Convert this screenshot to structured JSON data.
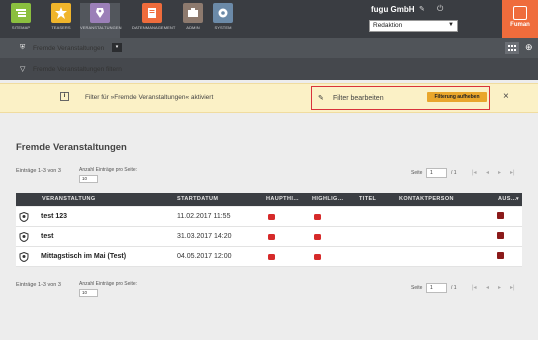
{
  "nav": {
    "items": [
      {
        "label": "SITEMAP",
        "color": "#8bbf3f"
      },
      {
        "label": "TEASERS",
        "color": "#f0b52b"
      },
      {
        "label": "VERANSTALTUNGEN",
        "color": "#9b7fb8"
      },
      {
        "label": "DATENMANAGEMENT",
        "color": "#ef6c3c"
      },
      {
        "label": "ADMIN",
        "color": "#8d7a6e"
      },
      {
        "label": "SYSTEM",
        "color": "#6b8aa8"
      }
    ],
    "active_index": 2,
    "company": "fugu GmbH",
    "redaktion": "Redaktion",
    "brand": "Fuman",
    "brand_color": "#ef6c3c"
  },
  "subbar": {
    "title": "Fremde Veranstaltungen",
    "filter_link": "Fremde Veranstaltungen filtern"
  },
  "banner": {
    "message": "Filter für »Fremde Veranstaltungen« aktiviert",
    "edit_label": "Filter bearbeiten",
    "remove_label": "Filterung aufheben",
    "close": "×"
  },
  "page": {
    "title": "Fremde Veranstaltungen",
    "entries_text": "Einträge 1-3 von 3",
    "per_page_label": "Anzahl Einträge pro Seite:",
    "per_page_value": "10",
    "pager_label": "Seite",
    "pager_value": "1",
    "pager_total": "/ 1"
  },
  "table": {
    "headers": [
      "VERANSTALTUNG",
      "STARTDATUM",
      "HAUPTHI…",
      "HIGHLIG…",
      "TITEL",
      "KONTAKTPERSON",
      "AUS…"
    ],
    "rows": [
      {
        "name": "test 123",
        "date": "11.02.2017 11:55"
      },
      {
        "name": "test",
        "date": "31.03.2017 14:20"
      },
      {
        "name": "Mittagstisch im Mai (Test)",
        "date": "04.05.2017 12:00"
      }
    ]
  }
}
